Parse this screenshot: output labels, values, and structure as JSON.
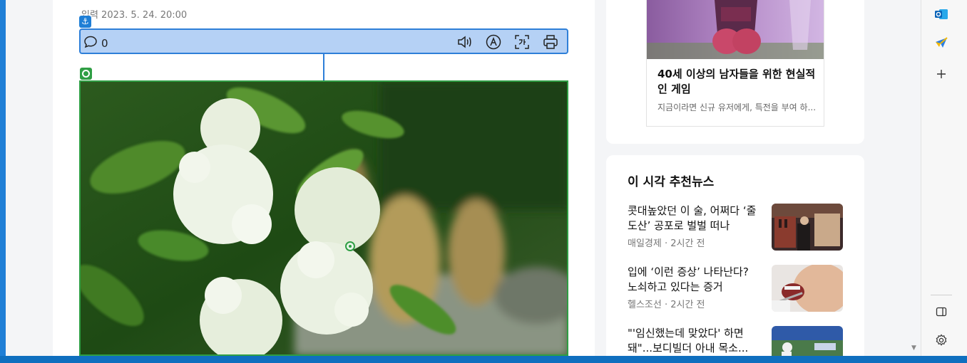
{
  "article": {
    "date_line": "입력 2023. 5. 24. 20:00",
    "comment_count": "0",
    "toolbar_icons": [
      "speaker-icon",
      "font-size-icon",
      "translate-icon",
      "print-icon"
    ],
    "photo_subject": "flowers-with-buddha-statues"
  },
  "ad": {
    "title": "40세 이상의 남자들을 위한 현실적인 게임",
    "description": "지금이라면 신규 유저에게, 특전을 부여 하..."
  },
  "news": {
    "heading": "이 시각 추천뉴스",
    "items": [
      {
        "title": "콧대높았던 이 술, 어쩌다 ‘줄도산’ 공포로 벌벌 떠나",
        "source": "매일경제 · 2시간 전"
      },
      {
        "title": "입에 ‘이런 증상’ 나타난다? 노쇠하고 있다는 증거",
        "source": "헬스조선 · 2시간 전"
      },
      {
        "title": "\"'임신했는데 맞았다' 하면 돼\"...보디빌더 아내 목소...",
        "source": ""
      }
    ]
  },
  "edge_sidebar": {
    "icons": [
      "outlook-icon",
      "send-icon",
      "add-icon",
      "sidebar-toggle-icon",
      "settings-icon"
    ]
  },
  "colors": {
    "accent_blue": "#2e7fd8",
    "toolbar_highlight": "#b5d1f5",
    "target_green": "#2f9e44",
    "frame_blue": "#1f7fd6"
  }
}
